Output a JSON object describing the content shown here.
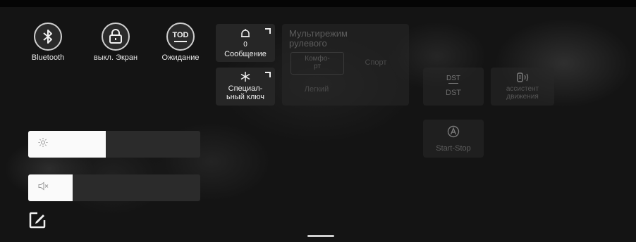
{
  "quick_buttons": [
    {
      "label": "Bluetooth",
      "icon": "bluetooth-icon"
    },
    {
      "label": "выкл. Экран",
      "icon": "lock-icon"
    },
    {
      "label": "Ожидание",
      "icon": "tod-icon",
      "icon_text": "TOD"
    }
  ],
  "tiles": {
    "message": {
      "label": "Сообщение",
      "icon": "bell-icon",
      "count": "0"
    },
    "special_key": {
      "label_line1": "Специал-",
      "label_line2": "ьный ключ",
      "icon": "asterisk-icon"
    }
  },
  "steering": {
    "title_line1": "Мультирежим",
    "title_line2": "рулевого",
    "options": [
      {
        "label_line1": "Комфо-",
        "label_line2": "рт"
      },
      {
        "label_line1": "Спорт",
        "label_line2": ""
      },
      {
        "label_line1": "Легкий",
        "label_line2": ""
      }
    ]
  },
  "ghost_tiles": {
    "dst": {
      "icon_text": "DST",
      "label": "DST"
    },
    "assistant": {
      "label_line1": "ассистент",
      "label_line2": "движения",
      "icon": "assist-icon"
    },
    "start_stop": {
      "label": "Start-Stop",
      "icon": "start-stop-icon"
    }
  },
  "sliders": {
    "brightness": {
      "level": 0.45,
      "icon": "brightness-icon"
    },
    "volume": {
      "level": 0.26,
      "icon": "mute-icon"
    }
  },
  "edit": {
    "icon": "edit-icon"
  },
  "colors": {
    "background": "#141414",
    "tile": "#262626",
    "fill": "#fafafa",
    "text": "#e6e6e6"
  }
}
